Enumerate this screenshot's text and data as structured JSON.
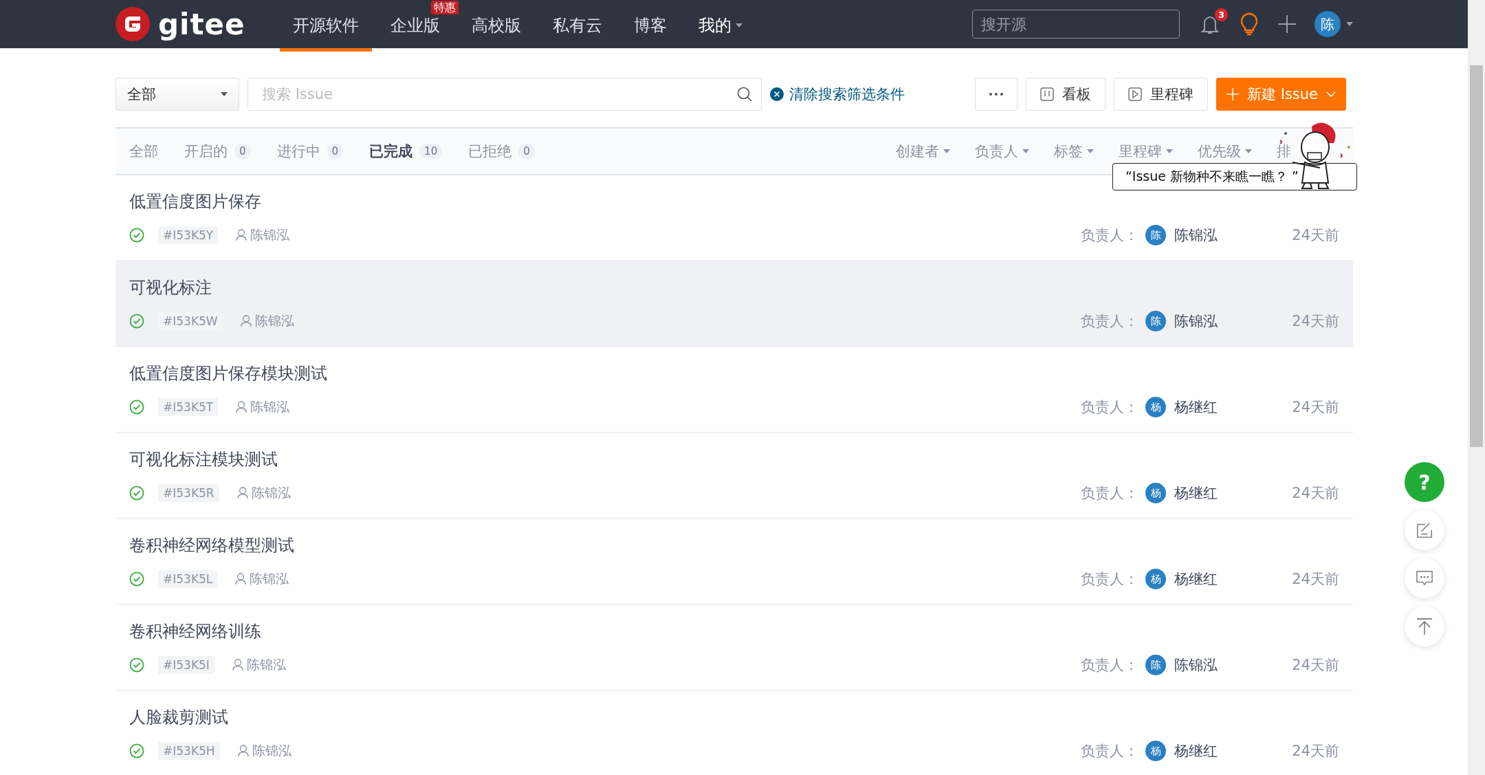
{
  "header": {
    "logo": "gitee",
    "nav": [
      {
        "label": "开源软件",
        "selected": true
      },
      {
        "label": "企业版",
        "badge": "特惠",
        "selected": false
      },
      {
        "label": "高校版",
        "selected": false
      },
      {
        "label": "私有云",
        "selected": false
      },
      {
        "label": "博客",
        "selected": false
      },
      {
        "label": "我的",
        "dropdown": true,
        "selected": false
      }
    ],
    "search": {
      "placeholder": "搜开源"
    },
    "notifications": "3",
    "avatar": "陈"
  },
  "toolbar": {
    "scope": "全部",
    "search": {
      "placeholder": "搜索 Issue"
    },
    "clear": "清除搜索筛选条件",
    "buttons": [
      {
        "kind": "more"
      },
      {
        "kind": "board",
        "label": "看板"
      },
      {
        "kind": "milestone",
        "label": "里程碑"
      },
      {
        "kind": "primary",
        "label": "新建 Issue"
      }
    ]
  },
  "tabs": [
    {
      "label": "全部",
      "selected": false
    },
    {
      "label": "开启的",
      "count": "0",
      "selected": false
    },
    {
      "label": "进行中",
      "count": "0",
      "selected": false
    },
    {
      "label": "已完成",
      "count": "10",
      "selected": true
    },
    {
      "label": "已拒绝",
      "count": "0",
      "selected": false
    }
  ],
  "filters": [
    {
      "label": "创建者",
      "dropdown": true
    },
    {
      "label": "负责人",
      "dropdown": true
    },
    {
      "label": "标签",
      "dropdown": true
    },
    {
      "label": "里程碑",
      "dropdown": true
    },
    {
      "label": "优先级",
      "dropdown": true
    },
    {
      "label": "排",
      "dropdown": false
    }
  ],
  "promo": "“Issue 新物种不来瞧一瞧？ ”",
  "issues": [
    {
      "title": "低置信度图片保存",
      "id": "#I53K5Y",
      "author": "陈锦泓",
      "assignee_label": "负责人：",
      "assignee_avatar": "陈",
      "assignee": "陈锦泓",
      "time": "24天前",
      "hovered": false
    },
    {
      "title": "可视化标注",
      "id": "#I53K5W",
      "author": "陈锦泓",
      "assignee_label": "负责人：",
      "assignee_avatar": "陈",
      "assignee": "陈锦泓",
      "time": "24天前",
      "hovered": true
    },
    {
      "title": "低置信度图片保存模块测试",
      "id": "#I53K5T",
      "author": "陈锦泓",
      "assignee_label": "负责人：",
      "assignee_avatar": "杨",
      "assignee": "杨继红",
      "time": "24天前",
      "hovered": false
    },
    {
      "title": "可视化标注模块测试",
      "id": "#I53K5R",
      "author": "陈锦泓",
      "assignee_label": "负责人：",
      "assignee_avatar": "杨",
      "assignee": "杨继红",
      "time": "24天前",
      "hovered": false
    },
    {
      "title": "卷积神经网络模型测试",
      "id": "#I53K5L",
      "author": "陈锦泓",
      "assignee_label": "负责人：",
      "assignee_avatar": "杨",
      "assignee": "杨继红",
      "time": "24天前",
      "hovered": false
    },
    {
      "title": "卷积神经网络训练",
      "id": "#I53K5I",
      "author": "陈锦泓",
      "assignee_label": "负责人：",
      "assignee_avatar": "陈",
      "assignee": "陈锦泓",
      "time": "24天前",
      "hovered": false
    },
    {
      "title": "人脸裁剪测试",
      "id": "#I53K5H",
      "author": "陈锦泓",
      "assignee_label": "负责人：",
      "assignee_avatar": "杨",
      "assignee": "杨继红",
      "time": "24天前",
      "hovered": false
    }
  ],
  "float_tools": [
    {
      "kind": "help",
      "label": "?"
    },
    {
      "kind": "edit"
    },
    {
      "kind": "chat"
    },
    {
      "kind": "top"
    }
  ]
}
